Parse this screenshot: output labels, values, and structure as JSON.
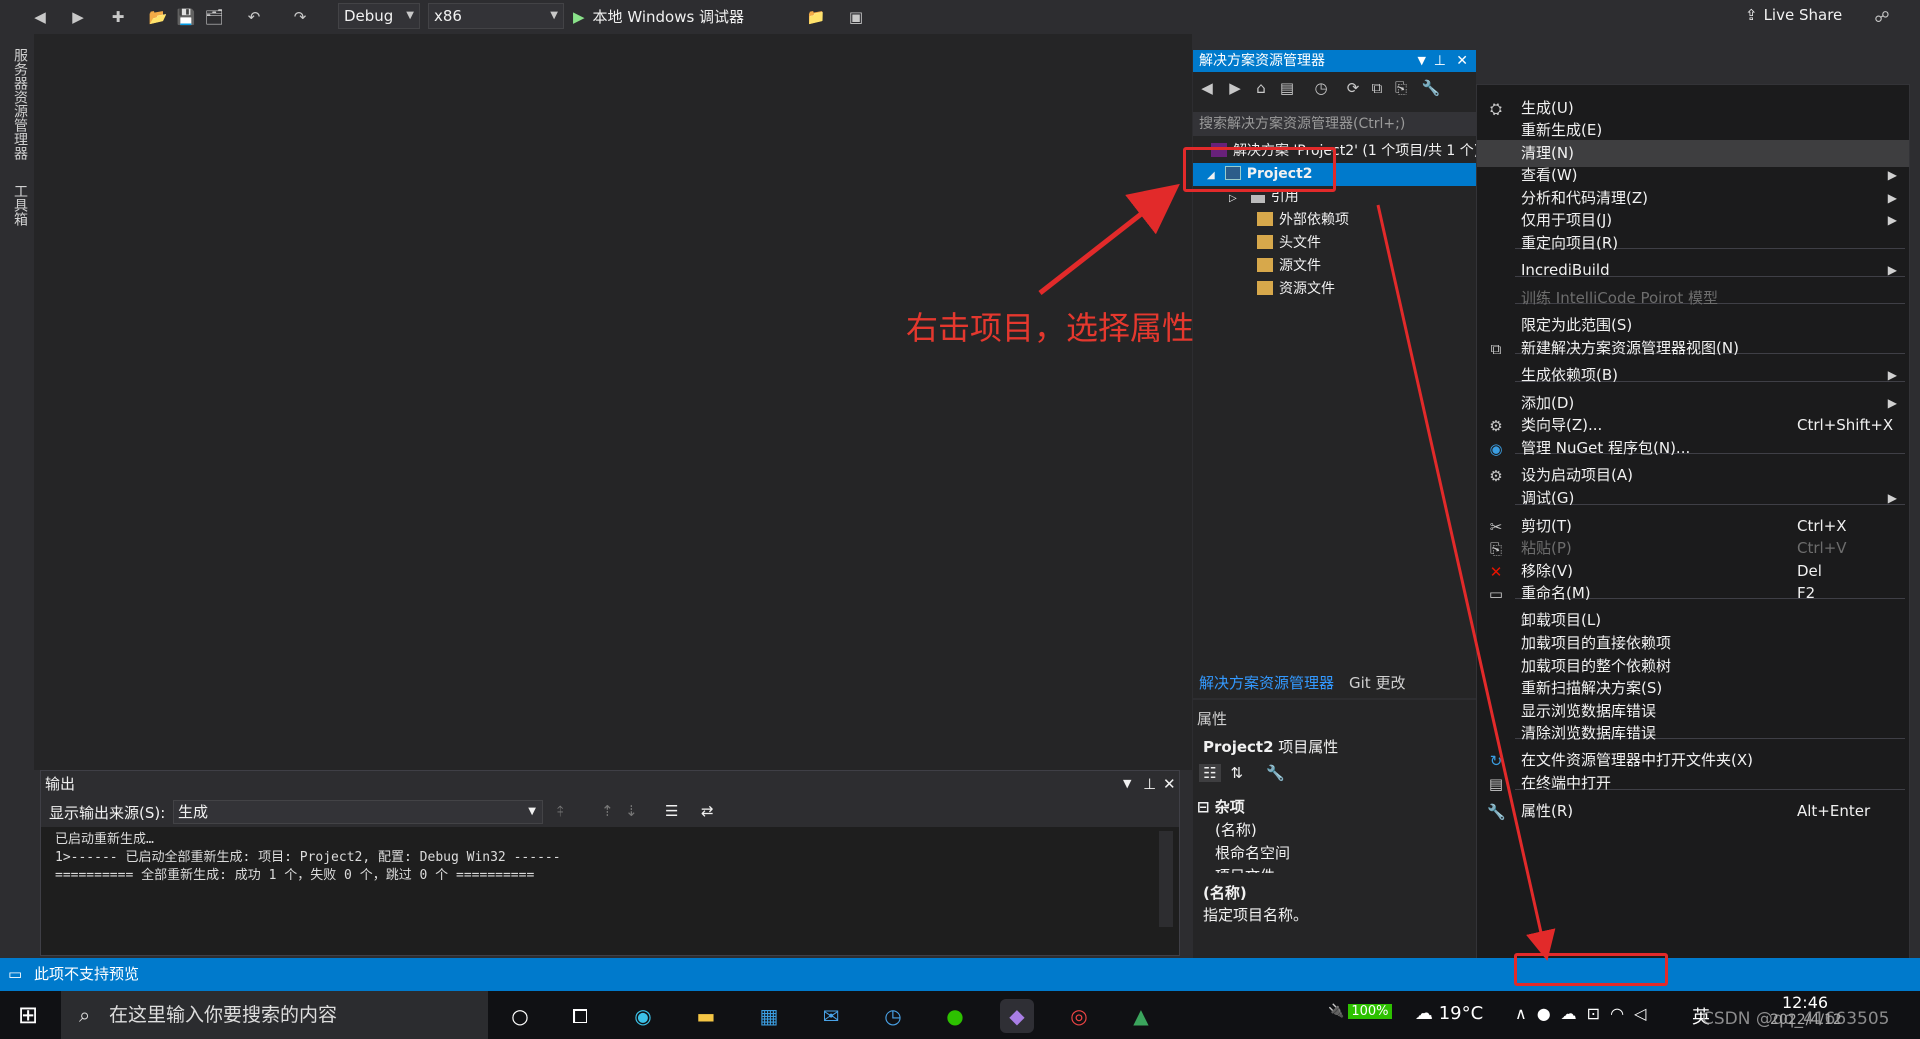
{
  "toolbar": {
    "config": "Debug",
    "platform": "x86",
    "run_label": "本地 Windows 调试器",
    "live_share": "Live Share"
  },
  "side_tabs": [
    "服务器资源管理器",
    "工具箱"
  ],
  "output": {
    "title": "输出",
    "source_label": "显示输出来源(S):",
    "source_value": "生成",
    "lines": [
      "已启动重新生成…",
      "1>------ 已启动全部重新生成: 项目: Project2, 配置: Debug Win32 ------",
      "========== 全部重新生成: 成功 1 个，失败 0 个，跳过 0 个 =========="
    ]
  },
  "solution_explorer": {
    "title": "解决方案资源管理器",
    "search_placeholder": "搜索解决方案资源管理器(Ctrl+;)",
    "solution_row": "解决方案 'Project2' (1 个项目/共 1 个)",
    "project_row": "Project2",
    "children": [
      "引用",
      "外部依赖项",
      "头文件",
      "源文件",
      "资源文件"
    ],
    "tabs": [
      "解决方案资源管理器",
      "Git 更改"
    ]
  },
  "properties": {
    "title": "属性",
    "object_name": "Project2",
    "object_type": "项目属性",
    "category": "杂项",
    "rows": [
      "(名称)",
      "根命名空间",
      "项目文件"
    ],
    "desc_title": "(名称)",
    "desc_text": "指定项目名称。"
  },
  "context_menu": {
    "items": [
      {
        "label": "生成(U)",
        "shortcut": "",
        "submenu": false,
        "icon": "build-icon"
      },
      {
        "label": "重新生成(E)",
        "shortcut": "",
        "submenu": false,
        "icon": ""
      },
      {
        "label": "清理(N)",
        "shortcut": "",
        "submenu": false,
        "icon": ""
      },
      {
        "label": "查看(W)",
        "shortcut": "",
        "submenu": true,
        "icon": ""
      },
      {
        "label": "分析和代码清理(Z)",
        "shortcut": "",
        "submenu": true,
        "icon": ""
      },
      {
        "label": "仅用于项目(J)",
        "shortcut": "",
        "submenu": true,
        "icon": ""
      },
      {
        "label": "重定向项目(R)",
        "shortcut": "",
        "submenu": false,
        "icon": ""
      },
      {
        "label": "IncrediBuild",
        "shortcut": "",
        "submenu": true,
        "icon": ""
      },
      {
        "label": "训练 IntelliCode Poirot 模型",
        "shortcut": "",
        "submenu": false,
        "icon": ""
      },
      {
        "label": "限定为此范围(S)",
        "shortcut": "",
        "submenu": false,
        "icon": ""
      },
      {
        "label": "新建解决方案资源管理器视图(N)",
        "shortcut": "",
        "submenu": false,
        "icon": "new-view-icon"
      },
      {
        "label": "生成依赖项(B)",
        "shortcut": "",
        "submenu": true,
        "icon": ""
      },
      {
        "label": "添加(D)",
        "shortcut": "",
        "submenu": true,
        "icon": ""
      },
      {
        "label": "类向导(Z)...",
        "shortcut": "Ctrl+Shift+X",
        "submenu": false,
        "icon": "class-wizard-icon"
      },
      {
        "label": "管理 NuGet 程序包(N)...",
        "shortcut": "",
        "submenu": false,
        "icon": "nuget-icon"
      },
      {
        "label": "设为启动项目(A)",
        "shortcut": "",
        "submenu": false,
        "icon": "gear-icon"
      },
      {
        "label": "调试(G)",
        "shortcut": "",
        "submenu": true,
        "icon": ""
      },
      {
        "label": "剪切(T)",
        "shortcut": "Ctrl+X",
        "submenu": false,
        "icon": "scissors-icon"
      },
      {
        "label": "粘贴(P)",
        "shortcut": "Ctrl+V",
        "submenu": false,
        "icon": "paste-icon"
      },
      {
        "label": "移除(V)",
        "shortcut": "Del",
        "submenu": false,
        "icon": "remove-icon"
      },
      {
        "label": "重命名(M)",
        "shortcut": "F2",
        "submenu": false,
        "icon": "rename-icon"
      },
      {
        "label": "卸载项目(L)",
        "shortcut": "",
        "submenu": false,
        "icon": ""
      },
      {
        "label": "加载项目的直接依赖项",
        "shortcut": "",
        "submenu": false,
        "icon": ""
      },
      {
        "label": "加载项目的整个依赖树",
        "shortcut": "",
        "submenu": false,
        "icon": ""
      },
      {
        "label": "重新扫描解决方案(S)",
        "shortcut": "",
        "submenu": false,
        "icon": ""
      },
      {
        "label": "显示浏览数据库错误",
        "shortcut": "",
        "submenu": false,
        "icon": ""
      },
      {
        "label": "清除浏览数据库错误",
        "shortcut": "",
        "submenu": false,
        "icon": ""
      },
      {
        "label": "在文件资源管理器中打开文件夹(X)",
        "shortcut": "",
        "submenu": false,
        "icon": "open-folder-icon"
      },
      {
        "label": "在终端中打开",
        "shortcut": "",
        "submenu": false,
        "icon": "terminal-icon"
      },
      {
        "label": "属性(R)",
        "shortcut": "Alt+Enter",
        "submenu": false,
        "icon": "wrench-icon"
      }
    ]
  },
  "annotation": "右击项目，选择属性",
  "status_bar": {
    "text": "此项不支持预览"
  },
  "taskbar": {
    "search_placeholder": "在这里输入你要搜索的内容",
    "battery": "100%",
    "temperature": "19°C",
    "ime": "英",
    "time": "12:46",
    "date": "2022/4/12",
    "watermark": "CSDN @qq_41663505"
  },
  "colors": {
    "accent": "#007acc",
    "annotation": "#e22a2a"
  }
}
